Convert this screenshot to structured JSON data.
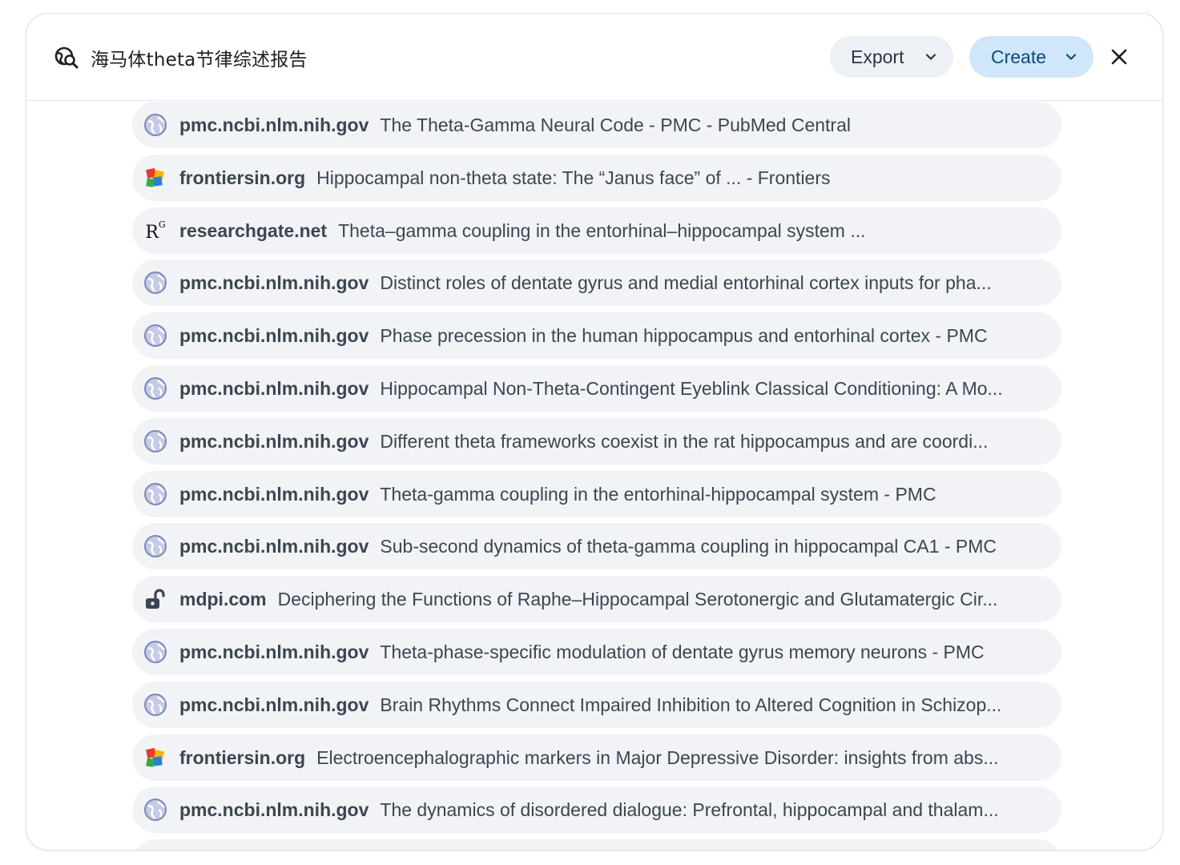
{
  "header": {
    "title": "海马体theta节律综述报告",
    "export_label": "Export",
    "create_label": "Create",
    "icons": {
      "title": "search-globe-icon",
      "chevron": "chevron-down-icon",
      "close": "close-icon"
    }
  },
  "colors": {
    "row_bg": "#f1f3f6",
    "export_bg": "#edf0f5",
    "create_bg": "#cfe6fb",
    "text": "#3c4552"
  },
  "sources": [
    {
      "icon": "globe",
      "domain": "pmc.ncbi.nlm.nih.gov",
      "title": "The Theta-Gamma Neural Code - PMC - PubMed Central"
    },
    {
      "icon": "frontiers",
      "domain": "frontiersin.org",
      "title": "Hippocampal non-theta state: The “Janus face” of ... - Frontiers"
    },
    {
      "icon": "researchgate",
      "domain": "researchgate.net",
      "title": "Theta–gamma coupling in the entorhinal–hippocampal system ..."
    },
    {
      "icon": "globe",
      "domain": "pmc.ncbi.nlm.nih.gov",
      "title": "Distinct roles of dentate gyrus and medial entorhinal cortex inputs for pha..."
    },
    {
      "icon": "globe",
      "domain": "pmc.ncbi.nlm.nih.gov",
      "title": "Phase precession in the human hippocampus and entorhinal cortex - PMC"
    },
    {
      "icon": "globe",
      "domain": "pmc.ncbi.nlm.nih.gov",
      "title": "Hippocampal Non-Theta-Contingent Eyeblink Classical Conditioning: A Mo..."
    },
    {
      "icon": "globe",
      "domain": "pmc.ncbi.nlm.nih.gov",
      "title": "Different theta frameworks coexist in the rat hippocampus and are coordi..."
    },
    {
      "icon": "globe",
      "domain": "pmc.ncbi.nlm.nih.gov",
      "title": "Theta-gamma coupling in the entorhinal-hippocampal system - PMC"
    },
    {
      "icon": "globe",
      "domain": "pmc.ncbi.nlm.nih.gov",
      "title": "Sub-second dynamics of theta-gamma coupling in hippocampal CA1 - PMC"
    },
    {
      "icon": "lock",
      "domain": "mdpi.com",
      "title": "Deciphering the Functions of Raphe–Hippocampal Serotonergic and Glutamatergic Cir..."
    },
    {
      "icon": "globe",
      "domain": "pmc.ncbi.nlm.nih.gov",
      "title": "Theta-phase-specific modulation of dentate gyrus memory neurons - PMC"
    },
    {
      "icon": "globe",
      "domain": "pmc.ncbi.nlm.nih.gov",
      "title": "Brain Rhythms Connect Impaired Inhibition to Altered Cognition in Schizop..."
    },
    {
      "icon": "frontiers",
      "domain": "frontiersin.org",
      "title": "Electroencephalographic markers in Major Depressive Disorder: insights from abs..."
    },
    {
      "icon": "globe",
      "domain": "pmc.ncbi.nlm.nih.gov",
      "title": "The dynamics of disordered dialogue: Prefrontal, hippocampal and thalam..."
    }
  ]
}
